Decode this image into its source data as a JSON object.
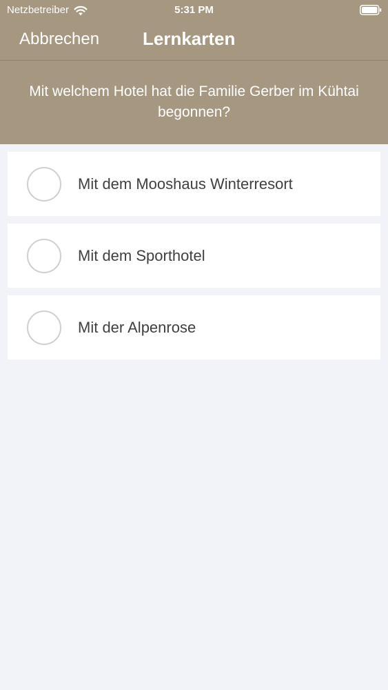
{
  "status_bar": {
    "carrier": "Netzbetreiber",
    "time": "5:31 PM",
    "wifi_icon": "wifi-icon",
    "battery_icon": "battery-icon"
  },
  "nav": {
    "cancel_label": "Abbrechen",
    "title": "Lernkarten"
  },
  "question": {
    "text": "Mit welchem Hotel hat die Familie Gerber im Kühtai begonnen?"
  },
  "answers": [
    {
      "label": "Mit dem Mooshaus Winterresort",
      "selected": false
    },
    {
      "label": "Mit dem Sporthotel",
      "selected": false
    },
    {
      "label": "Mit der Alpenrose",
      "selected": false
    }
  ],
  "colors": {
    "header_background": "#a69880",
    "page_background": "#f2f3f8",
    "card_background": "#ffffff",
    "radio_border": "#cfcfcf",
    "answer_text": "#3f3f3f"
  }
}
